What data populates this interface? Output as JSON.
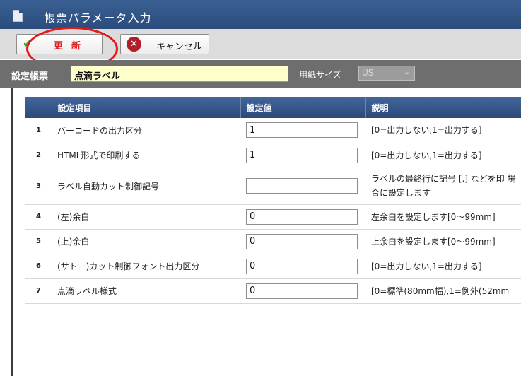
{
  "window": {
    "title": "帳票パラメータ入力",
    "icon": "document-icon"
  },
  "toolbar": {
    "update_label": "更新",
    "update_icon": "checkmark-icon",
    "cancel_label": "キャンセル",
    "cancel_icon": "cancel-x-icon"
  },
  "settings": {
    "form_label": "設定帳票",
    "form_value": "点滴ラベル",
    "paper_label": "用紙サイズ",
    "paper_value": "US"
  },
  "table": {
    "headers": [
      "",
      "設定項目",
      "設定値",
      "説明"
    ],
    "rows": [
      {
        "no": "1",
        "item": "バーコードの出力区分",
        "value": "1",
        "desc": "[0=出力しない,1=出力する]"
      },
      {
        "no": "2",
        "item": "HTML形式で印刷する",
        "value": "1",
        "desc": "[0=出力しない,1=出力する]"
      },
      {
        "no": "3",
        "item": "ラベル自動カット制御記号",
        "value": "",
        "desc": "ラベルの最終行に記号 [.] などを印 場合に設定します"
      },
      {
        "no": "4",
        "item": "(左)余白",
        "value": "0",
        "desc": "左余白を設定します[0～99mm]"
      },
      {
        "no": "5",
        "item": "(上)余白",
        "value": "0",
        "desc": "上余白を設定します[0～99mm]"
      },
      {
        "no": "6",
        "item": "(サトー)カット制御フォント出力区分",
        "value": "0",
        "desc": "[0=出力しない,1=出力する]"
      },
      {
        "no": "7",
        "item": "点滴ラベル様式",
        "value": "0",
        "desc": "[0=標準(80mm幅),1=例外(52mm"
      }
    ]
  },
  "colors": {
    "titlebar": "#2f5386",
    "annotation_circle": "#e51818",
    "update_text": "#e02020"
  }
}
